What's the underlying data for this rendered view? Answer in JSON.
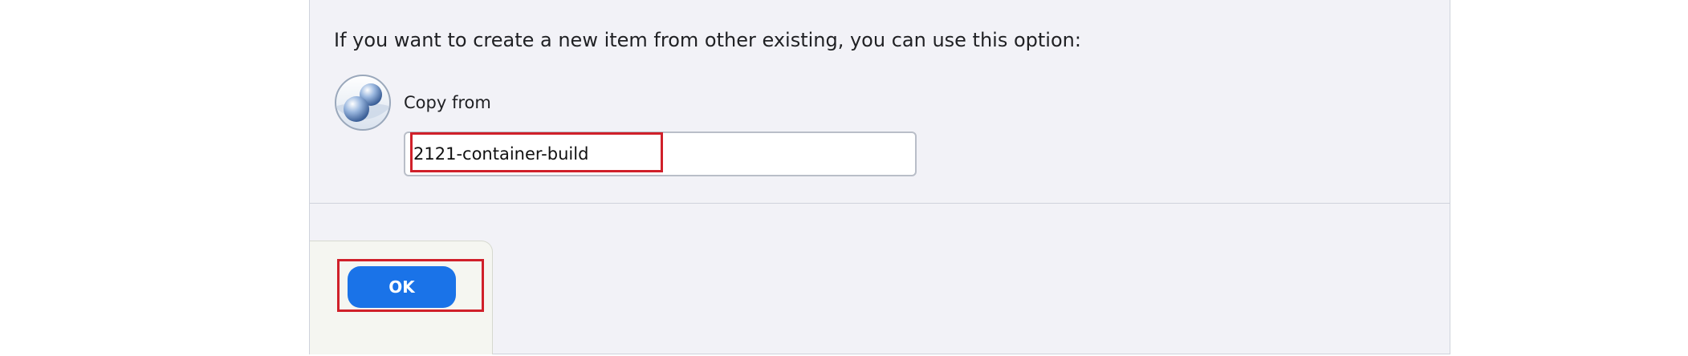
{
  "form": {
    "instruction": "If you want to create a new item from other existing, you can use this option:",
    "copy_from_label": "Copy from",
    "copy_from_value": "2121-container-build",
    "copy_icon": "copy-spheres-icon"
  },
  "actions": {
    "ok_label": "OK"
  },
  "colors": {
    "panel_bg": "#f2f2f7",
    "primary": "#1a73e8",
    "highlight": "#d0202a"
  }
}
